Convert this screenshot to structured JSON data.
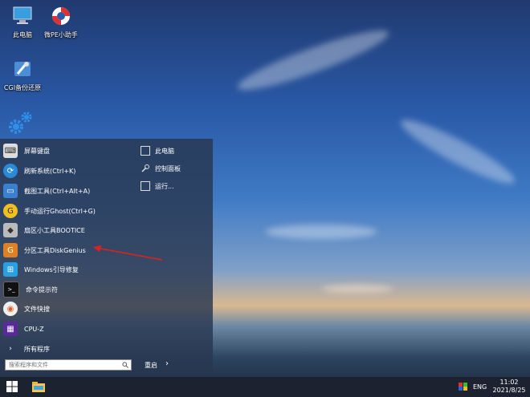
{
  "desktop": {
    "icons": [
      {
        "label": "此电脑"
      },
      {
        "label": "微PE小助手"
      },
      {
        "label": "CGI备份还原"
      }
    ]
  },
  "start_menu": {
    "items": [
      {
        "label": "屏幕键盘",
        "icon": "keyboard-icon"
      },
      {
        "label": "刷新系统(Ctrl+K)",
        "icon": "refresh-icon"
      },
      {
        "label": "截图工具(Ctrl+Alt+A)",
        "icon": "screenshot-icon"
      },
      {
        "label": "手动运行Ghost(Ctrl+G)",
        "icon": "ghost-icon"
      },
      {
        "label": "扇区小工具BOOTICE",
        "icon": "bootice-icon"
      },
      {
        "label": "分区工具DiskGenius",
        "icon": "diskgenius-icon"
      },
      {
        "label": "Windows引导修复",
        "icon": "windows-repair-icon"
      },
      {
        "label": "命令提示符",
        "icon": "cmd-icon"
      },
      {
        "label": "文件快搜",
        "icon": "file-search-icon"
      },
      {
        "label": "CPU-Z",
        "icon": "cpu-z-icon"
      },
      {
        "label": "所有程序",
        "icon": "all-programs-icon"
      }
    ],
    "right_items": [
      {
        "label": "此电脑"
      },
      {
        "label": "控制面板"
      },
      {
        "label": "运行..."
      }
    ],
    "search_placeholder": "搜索程序和文件",
    "restart_label": "重启"
  },
  "taskbar": {
    "language": "ENG",
    "time": "11:02",
    "date": "2021/8/25"
  },
  "colors": {
    "arrow": "#e02020",
    "menu_bg": "#28374f"
  }
}
